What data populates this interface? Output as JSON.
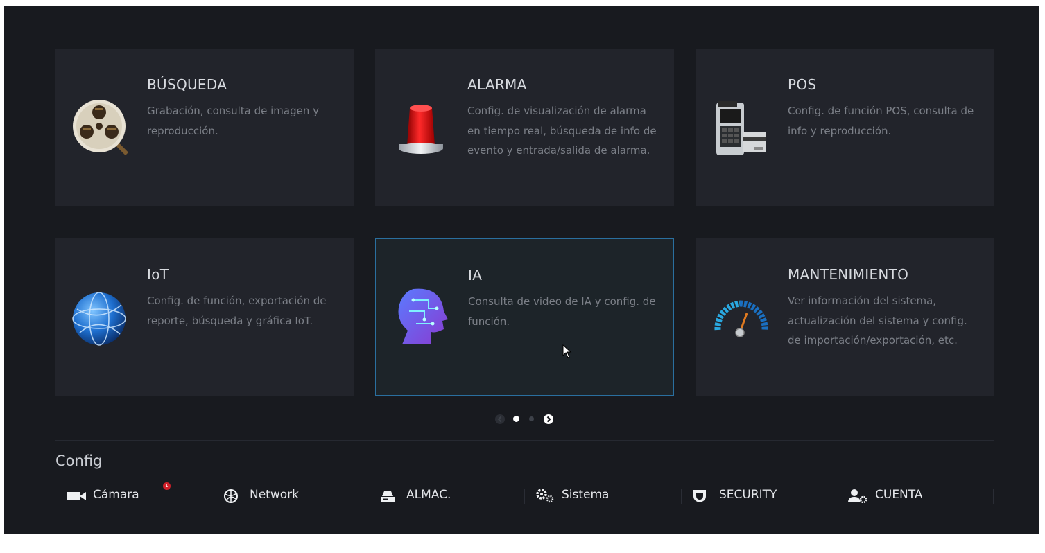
{
  "tiles": [
    {
      "title": "BÚSQUEDA",
      "desc": "Grabación, consulta de imagen y reproducción.",
      "icon": "film-reel-icon"
    },
    {
      "title": "ALARMA",
      "desc": "Config. de visualización de alarma en tiempo real, búsqueda de info de evento y entrada/salida de alarma.",
      "icon": "alarm-siren-icon"
    },
    {
      "title": "POS",
      "desc": "Config. de función POS, consulta de info y reproducción.",
      "icon": "pos-terminal-icon"
    },
    {
      "title": "IoT",
      "desc": "Config. de función, exportación de reporte, búsqueda y gráfica IoT.",
      "icon": "globe-icon"
    },
    {
      "title": "IA",
      "desc": "Consulta de video de IA y config. de función.",
      "icon": "ai-head-icon"
    },
    {
      "title": "MANTENIMIENTO",
      "desc": "Ver información del sistema, actualización del sistema y config. de importación/exportación, etc.",
      "icon": "gauge-icon"
    }
  ],
  "pager": {
    "current_page": 1,
    "total_pages": 2
  },
  "config": {
    "title": "Config",
    "items": [
      {
        "label": "Cámara",
        "icon": "camera-icon",
        "badge": "1"
      },
      {
        "label": "Network",
        "icon": "network-globe-icon"
      },
      {
        "label": "ALMAC.",
        "icon": "storage-drive-icon"
      },
      {
        "label": "Sistema",
        "icon": "gears-icon"
      },
      {
        "label": "SECURITY",
        "icon": "shield-icon"
      },
      {
        "label": "CUENTA",
        "icon": "user-settings-icon"
      }
    ]
  },
  "colors": {
    "background": "#181a1f",
    "tile": "#22242b",
    "tile_active_border": "#2a6f9f",
    "badge": "#d0202a"
  }
}
